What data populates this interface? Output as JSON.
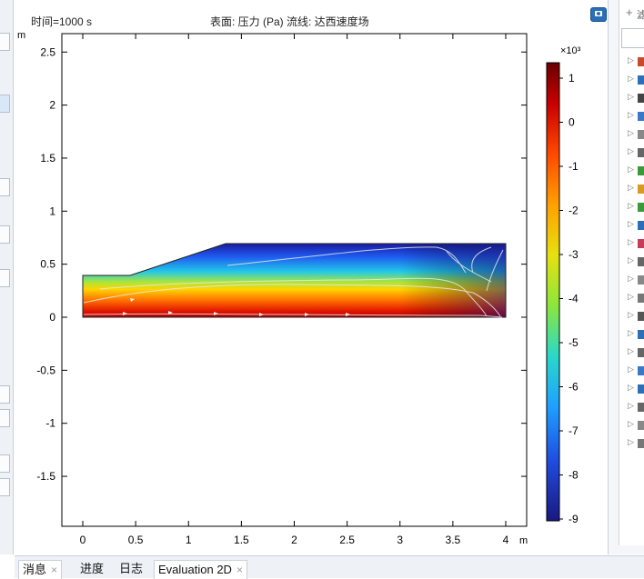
{
  "plot": {
    "title_left": "时间=1000 s",
    "title_center": "表面: 压力 (Pa)  流线: 达西速度场",
    "x_unit": "m",
    "y_unit": "m",
    "x_ticks": [
      "0",
      "0.5",
      "1",
      "1.5",
      "2",
      "2.5",
      "3",
      "3.5",
      "4"
    ],
    "y_ticks": [
      "2.5",
      "2",
      "1.5",
      "1",
      "0.5",
      "0",
      "-0.5",
      "-1",
      "-1.5"
    ],
    "colorbar_unit": "×10³",
    "colorbar_ticks": [
      "1",
      "0",
      "-1",
      "-2",
      "-3",
      "-4",
      "-5",
      "-6",
      "-7",
      "-8",
      "-9"
    ],
    "colormap": [
      "#7a0000",
      "#e01a00",
      "#ff7a00",
      "#ffd400",
      "#c8e620",
      "#32d8d0",
      "#1f8fff",
      "#1f3cd8",
      "#1a1880"
    ]
  },
  "tabs": [
    {
      "label": "消息",
      "closable": "×"
    },
    {
      "label": "进度"
    },
    {
      "label": "日志"
    },
    {
      "label": "Evaluation 2D",
      "closable": "×"
    }
  ],
  "right_panel": {
    "add_icon": "+",
    "label_fragment": "滤"
  }
}
